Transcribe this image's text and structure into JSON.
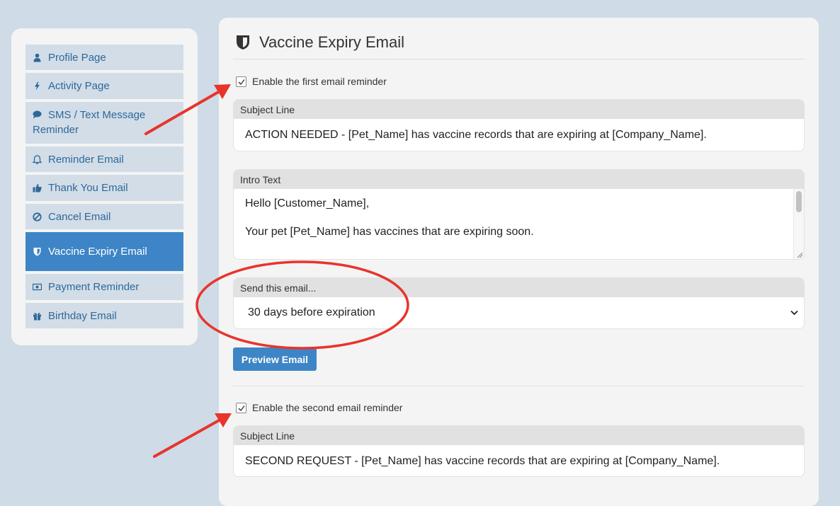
{
  "sidebar": {
    "items": [
      {
        "label": "Profile Page",
        "icon": "user-icon"
      },
      {
        "label": "Activity Page",
        "icon": "bolt-icon"
      },
      {
        "label": "SMS / Text Message Reminder",
        "icon": "comment-icon"
      },
      {
        "label": "Reminder Email",
        "icon": "bell-icon"
      },
      {
        "label": "Thank You Email",
        "icon": "thumbs-up-icon"
      },
      {
        "label": "Cancel Email",
        "icon": "ban-icon"
      },
      {
        "label": "Vaccine Expiry Email",
        "icon": "shield-icon",
        "active": true
      },
      {
        "label": "Payment Reminder",
        "icon": "money-icon"
      },
      {
        "label": "Birthday Email",
        "icon": "gift-icon"
      }
    ]
  },
  "main": {
    "title": "Vaccine Expiry Email",
    "title_icon": "shield-icon",
    "first_reminder": {
      "enable_label": "Enable the first email reminder",
      "enabled": true,
      "subject_label": "Subject Line",
      "subject_value": "ACTION NEEDED - [Pet_Name] has vaccine records that are expiring at [Company_Name].",
      "intro_label": "Intro Text",
      "intro_line1": "Hello [Customer_Name],",
      "intro_line2": "Your pet [Pet_Name] has vaccines that are expiring soon.",
      "send_label": "Send this email...",
      "send_value": "30 days before expiration"
    },
    "preview_button": "Preview Email",
    "second_reminder": {
      "enable_label": "Enable the second email reminder",
      "enabled": true,
      "subject_label": "Subject Line",
      "subject_value": "SECOND REQUEST - [Pet_Name] has vaccine records that are expiring at [Company_Name]."
    }
  },
  "colors": {
    "page_bg": "#cfdbe6",
    "panel_bg": "#f4f4f4",
    "nav_bg": "#d2dde8",
    "nav_text": "#2f6898",
    "accent": "#3d85c6",
    "annotation": "#e8342c"
  }
}
